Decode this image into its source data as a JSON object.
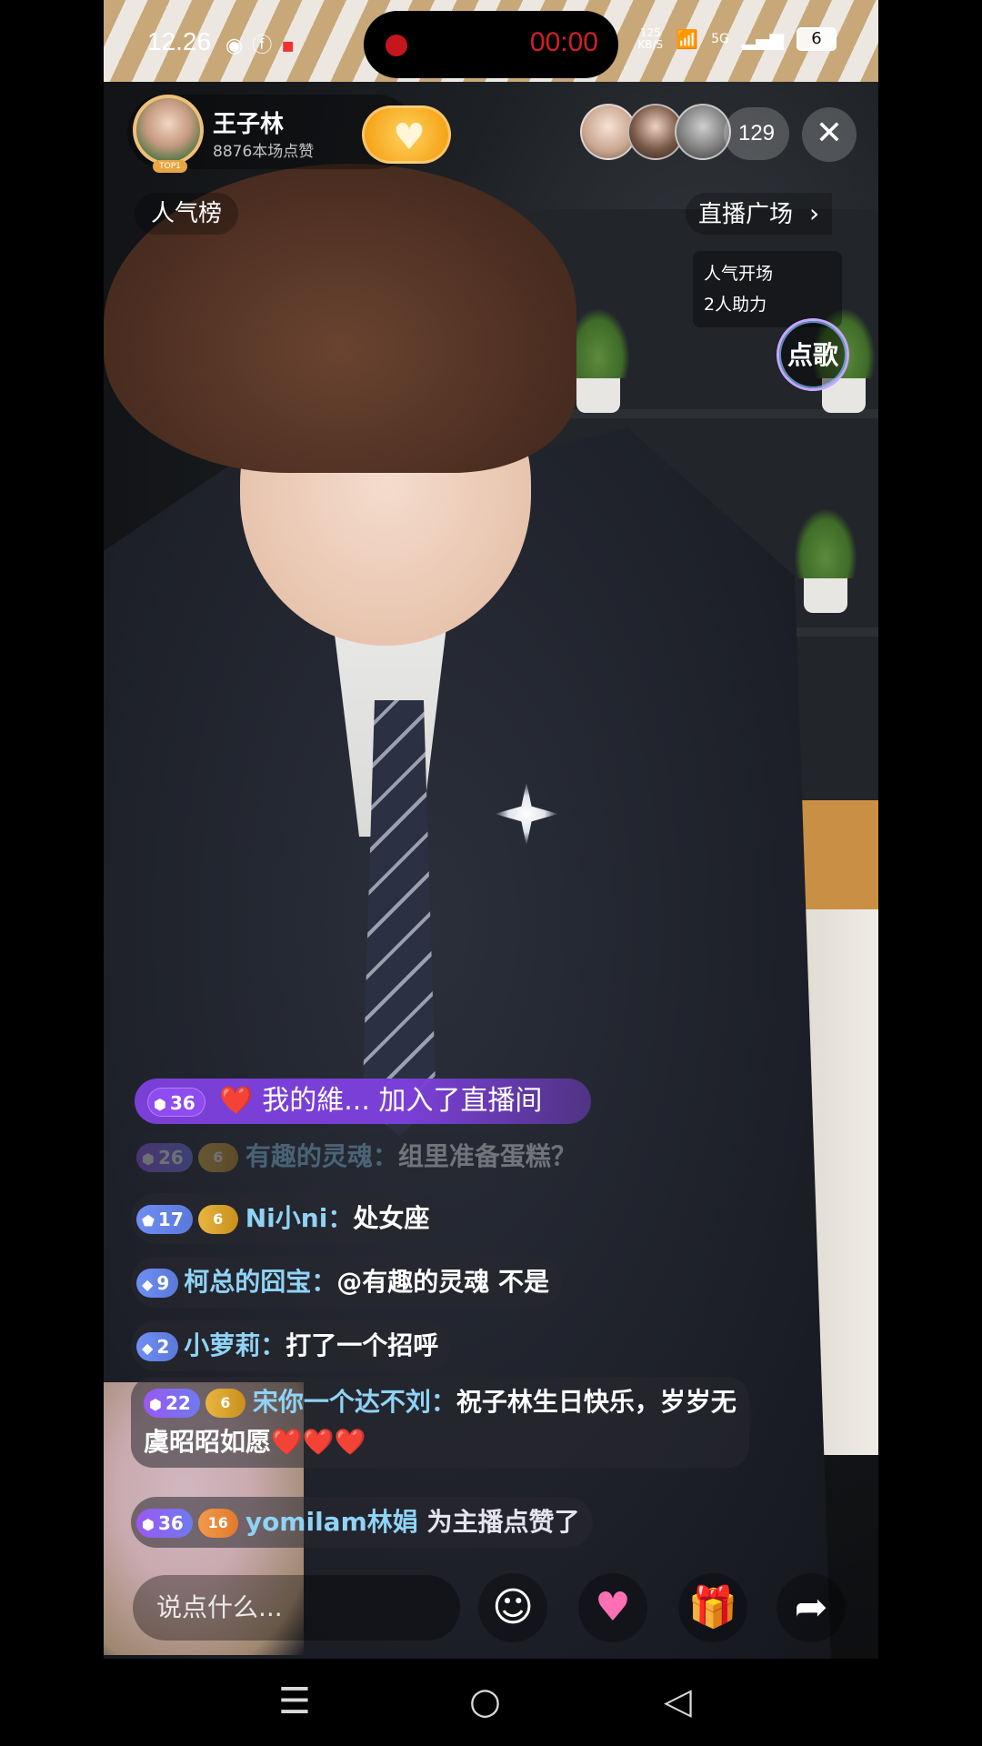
{
  "status_bar": {
    "time": "12.26",
    "left_icons": [
      "chrome-shield-icon",
      "facebook-icon",
      "notification-icon"
    ],
    "recording_timer": "00:00",
    "network_speed": "125\nKB/S",
    "network_type": "5G",
    "battery": "6"
  },
  "host": {
    "name": "王子林",
    "likes": "8876本场点赞",
    "badge": "TOP1"
  },
  "viewers": {
    "count": "129"
  },
  "tags": {
    "left": "人气榜",
    "right": "直播广场"
  },
  "popular_start": {
    "line1": "人气开场",
    "line2": "2人助力"
  },
  "song_button": "点歌",
  "join_notice": {
    "level": "36",
    "heart": "❤️",
    "text": "我的維... 加入了直播间"
  },
  "chat": [
    {
      "level": "26",
      "fan": "6",
      "user": "有趣的灵魂",
      "message": "组里准备蛋糕？"
    },
    {
      "level": "17",
      "fan": "6",
      "user": "Ni小ni",
      "message": "处女座"
    },
    {
      "level": "9",
      "user": "柯总的囧宝",
      "message": "@有趣的灵魂 不是"
    },
    {
      "level": "2",
      "user": "小萝莉",
      "message": "打了一个招呼"
    },
    {
      "level": "22",
      "fan": "6",
      "user": "宋你一个达不刘",
      "message": "祝子林生日快乐，岁岁无虞昭昭如愿❤️❤️❤️"
    },
    {
      "level": "36",
      "fan": "16",
      "user": "yomilam林娟",
      "message": "为主播点赞了"
    }
  ],
  "input": {
    "placeholder": "说点什么..."
  },
  "colors": {
    "username": "#8fd3f6",
    "join_bg": "#7a3fd6",
    "recording_red": "#d11f26",
    "follow_gold": "#f6a51a"
  }
}
